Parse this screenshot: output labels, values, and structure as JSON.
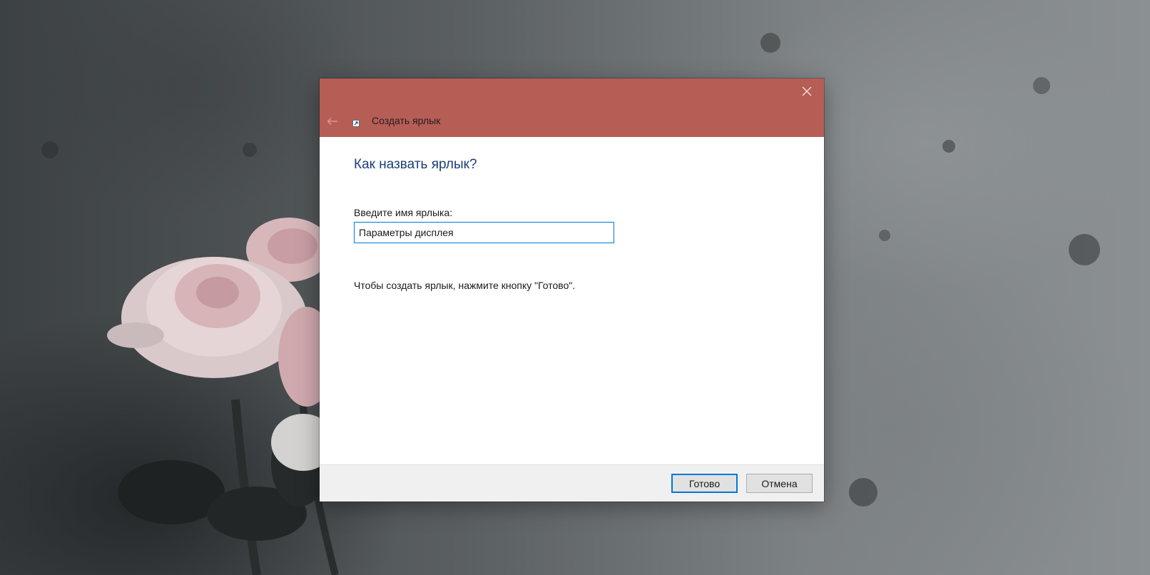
{
  "window": {
    "title": "Создать ярлык",
    "accent_color": "#b65d56"
  },
  "icons": {
    "close": "close-icon",
    "back": "back-arrow-icon",
    "app": "shortcut-icon"
  },
  "main": {
    "heading": "Как назвать ярлык?",
    "field_label": "Введите имя ярлыка:",
    "name_value": "Параметры дисплея",
    "hint": "Чтобы создать ярлык, нажмите кнопку \"Готово\"."
  },
  "footer": {
    "finish_label": "Готово",
    "cancel_label": "Отмена"
  }
}
